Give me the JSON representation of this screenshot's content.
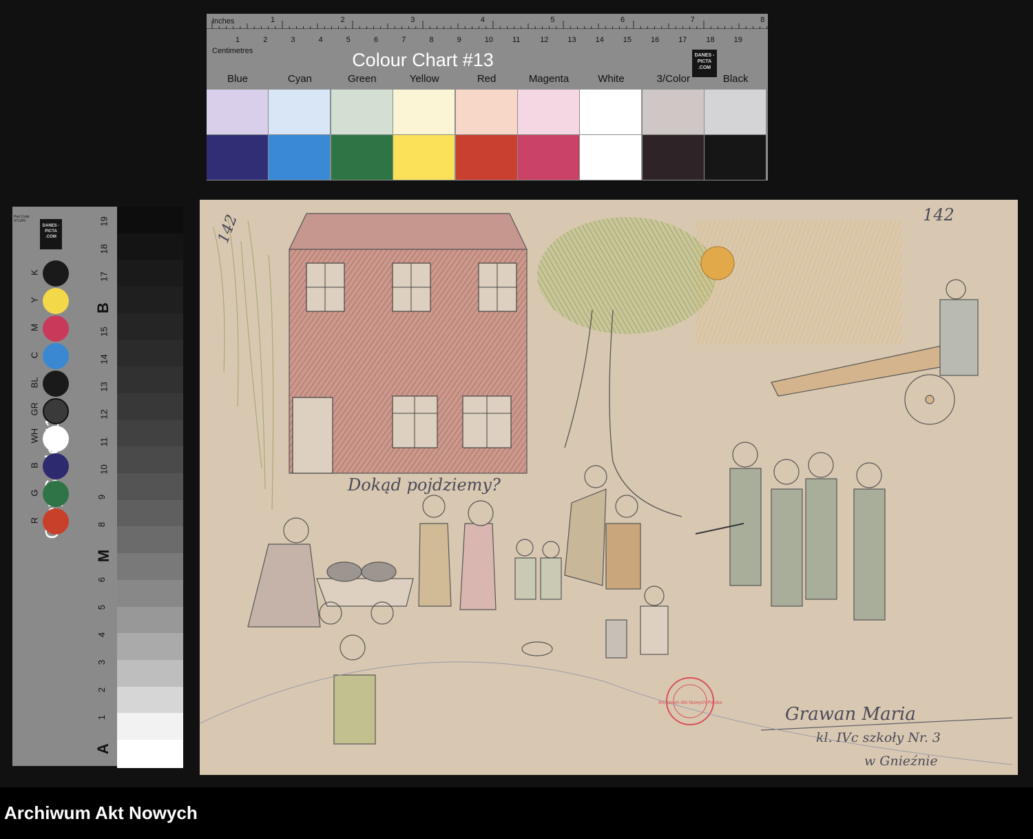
{
  "colour_chart": {
    "inches_label": "Inches",
    "centimetres_label": "Centimetres",
    "inch_numbers": [
      "1",
      "2",
      "3",
      "4",
      "5",
      "6",
      "7",
      "8"
    ],
    "cm_numbers": [
      "1",
      "2",
      "3",
      "4",
      "5",
      "6",
      "7",
      "8",
      "9",
      "10",
      "11",
      "12",
      "13",
      "14",
      "15",
      "16",
      "17",
      "18",
      "19"
    ],
    "title": "Colour Chart #13",
    "logo_text": "DANES -PICTA .COM",
    "labels": [
      "Blue",
      "Cyan",
      "Green",
      "Yellow",
      "Red",
      "Magenta",
      "White",
      "3/Color",
      "Black"
    ],
    "light_colors": [
      "#d9cfea",
      "#d9e6f6",
      "#d3dfd3",
      "#fbf5d6",
      "#f7d8c8",
      "#f5d6e3",
      "#ffffff",
      "#cfc7c6",
      "#d4d4d6"
    ],
    "dark_colors": [
      "#302e75",
      "#3a89d6",
      "#2e7545",
      "#fbe05a",
      "#c9402e",
      "#cb4267",
      "#ffffff",
      "#2e2427",
      "#161616"
    ]
  },
  "grey_scale": {
    "title": "Grey Scale #13",
    "small_text": "Part Code ST13HI",
    "logo_text": "DANES -PICTA .COM",
    "dots": [
      {
        "label": "K",
        "color": "#1a1a1a"
      },
      {
        "label": "Y",
        "color": "#f3d84a"
      },
      {
        "label": "M",
        "color": "#c9395a"
      },
      {
        "label": "C",
        "color": "#3b88d2"
      },
      {
        "label": "BL",
        "color": "#1a1a1a"
      },
      {
        "label": "GR",
        "color": "#3a3a3a"
      },
      {
        "label": "WH",
        "color": "#ffffff"
      },
      {
        "label": "B",
        "color": "#2e2a70"
      },
      {
        "label": "G",
        "color": "#2f7446"
      },
      {
        "label": "R",
        "color": "#c8402a"
      }
    ],
    "numbers": [
      "19",
      "18",
      "17",
      "B",
      "15",
      "14",
      "13",
      "12",
      "11",
      "10",
      "9",
      "8",
      "M",
      "6",
      "5",
      "4",
      "3",
      "2",
      "1",
      "A"
    ],
    "steps": [
      "#0d0d0d",
      "#141414",
      "#1a1a1a",
      "#1f1f1f",
      "#252525",
      "#2b2b2b",
      "#313131",
      "#383838",
      "#414141",
      "#4a4a4a",
      "#545454",
      "#5f5f5f",
      "#6b6b6b",
      "#797979",
      "#888888",
      "#989898",
      "#aaaaaa",
      "#bebebe",
      "#d6d6d6",
      "#f2f2f2",
      "#ffffff"
    ]
  },
  "drawing": {
    "page_number_left": "142",
    "page_number_right": "142",
    "caption": "Dokąd pojdziemy?",
    "signature_name": "Grawan Maria",
    "signature_class": "kl. IVc szkoły Nr. 3",
    "signature_town": "w Gnieźnie",
    "stamp_text": "Archiwum Akt Nowych Polska"
  },
  "footer": {
    "text": "Archiwum Akt Nowych"
  }
}
